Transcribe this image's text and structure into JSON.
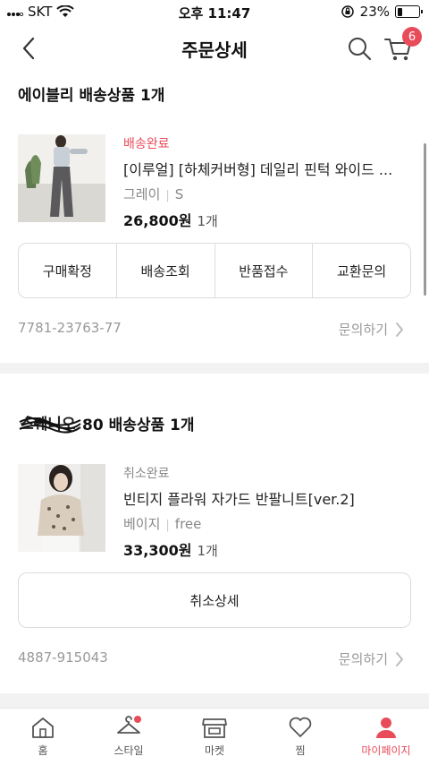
{
  "status_bar": {
    "carrier": "SKT",
    "time": "오후 11:47",
    "battery_text": "23%",
    "battery_level": 0.23
  },
  "header": {
    "title": "주문상세",
    "cart_count": "6"
  },
  "sections": [
    {
      "shop_name": "에이블리 배송상품 1개",
      "item": {
        "status": "배송완료",
        "name": "[이루얼] [하체커버형] 데일리 핀턱 와이드 ...",
        "color": "그레이",
        "size": "S",
        "price": "26,800원",
        "quantity": "1개"
      },
      "buttons": [
        "구매확정",
        "배송조회",
        "반품접수",
        "교환문의"
      ],
      "order_number": "7781-23763-77",
      "inquiry_label": "문의하기"
    },
    {
      "shop_name_suffix": "80 배송상품 1개",
      "item": {
        "status": "취소완료",
        "name": "빈티지 플라워 자가드 반팔니트[ver.2]",
        "color": "베이지",
        "size": "free",
        "price": "33,300원",
        "quantity": "1개"
      },
      "button": "취소상세",
      "order_number": "4887-915043",
      "inquiry_label": "문의하기"
    }
  ],
  "tabbar": {
    "tabs": [
      {
        "label": "홈",
        "icon": "home-icon"
      },
      {
        "label": "스타일",
        "icon": "hanger-icon"
      },
      {
        "label": "마켓",
        "icon": "store-icon"
      },
      {
        "label": "찜",
        "icon": "heart-icon"
      },
      {
        "label": "마이페이지",
        "icon": "person-icon"
      }
    ],
    "active_tab": "마이페이지"
  },
  "colors": {
    "accent": "#e84c5a",
    "muted_text": "#999999",
    "divider": "#f2f2f2",
    "border": "#dcdcdc"
  }
}
